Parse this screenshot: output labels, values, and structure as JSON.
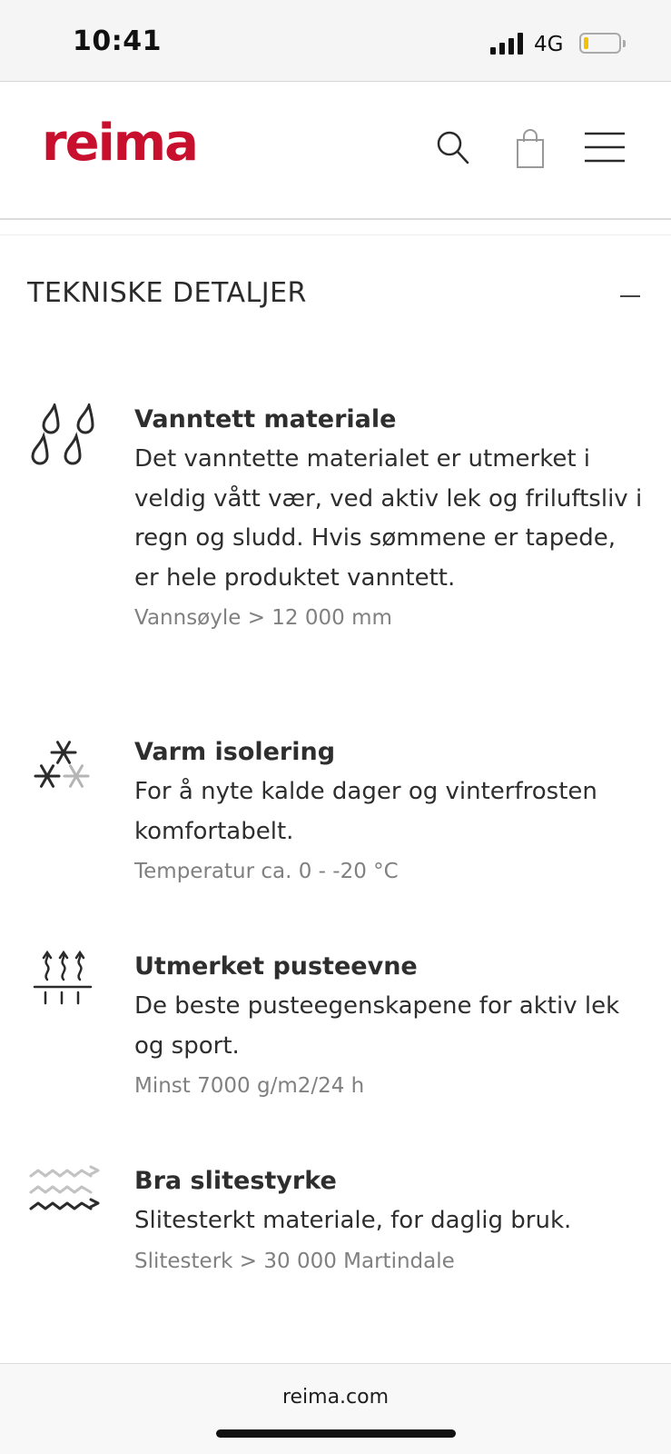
{
  "status_bar": {
    "time": "10:41",
    "network": "4G"
  },
  "header": {
    "logo": "reima"
  },
  "section": {
    "title": "TEKNISKE DETALJER"
  },
  "features": [
    {
      "icon": "water-drops-icon",
      "title": "Vanntett materiale",
      "description": "Det vanntette materialet er utmerket i veldig vått vær, ved aktiv lek og friluftsliv i regn og sludd. Hvis sømmene er tapede, er hele produktet vanntett.",
      "spec": "Vannsøyle > 12 000 mm"
    },
    {
      "icon": "snowflake-icon",
      "title": "Varm isolering",
      "description": "For å nyte kalde dager og vinterfrosten komfortabelt.",
      "spec": "Temperatur ca. 0 - -20 °C"
    },
    {
      "icon": "breathability-icon",
      "title": "Utmerket pusteevne",
      "description": "De beste pusteegenskapene for aktiv lek og sport.",
      "spec": "Minst 7000 g/m2/24 h"
    },
    {
      "icon": "abrasion-icon",
      "title": "Bra slitestyrke",
      "description": "Slitesterkt materiale, for daglig bruk.",
      "spec": "Slitesterk > 30 000 Martindale"
    }
  ],
  "footer": {
    "domain": "reima.com"
  },
  "colors": {
    "brand": "#c8102e",
    "battery": "#f2c200"
  }
}
